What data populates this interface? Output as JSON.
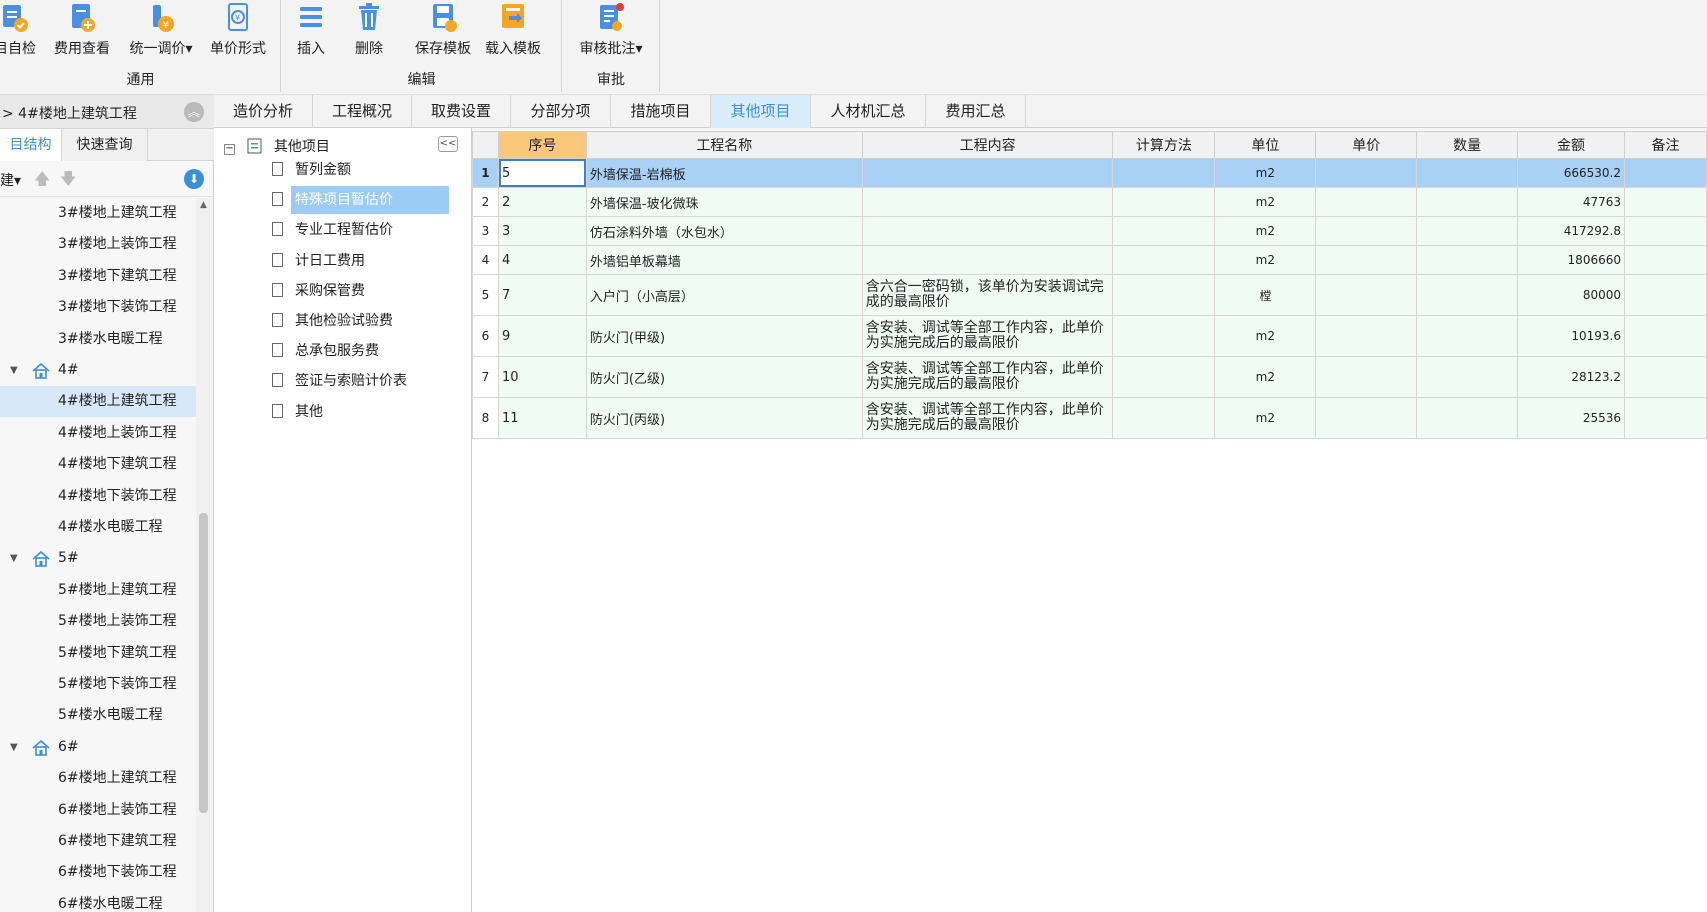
{
  "ribbon": {
    "groups": [
      {
        "name": "通用",
        "buttons": [
          "目自检",
          "费用查看",
          "统一调价▾",
          "单价形式"
        ]
      },
      {
        "name": "编辑",
        "buttons": [
          "插入",
          "删除",
          "保存模板",
          "载入模板"
        ]
      },
      {
        "name": "审批",
        "buttons": [
          "审核批注▾"
        ]
      }
    ]
  },
  "project": {
    "breadcrumb": "> 4#楼地上建筑工程",
    "tabs": [
      "目结构",
      "快速查询"
    ],
    "new_label": "建▾"
  },
  "tree": [
    {
      "label": "3#楼地上建筑工程",
      "type": "leaf"
    },
    {
      "label": "3#楼地上装饰工程",
      "type": "leaf"
    },
    {
      "label": "3#楼地下建筑工程",
      "type": "leaf"
    },
    {
      "label": "3#楼地下装饰工程",
      "type": "leaf"
    },
    {
      "label": "3#楼水电暖工程",
      "type": "leaf"
    },
    {
      "label": "4#",
      "type": "folder"
    },
    {
      "label": "4#楼地上建筑工程",
      "type": "leaf",
      "selected": true
    },
    {
      "label": "4#楼地上装饰工程",
      "type": "leaf"
    },
    {
      "label": "4#楼地下建筑工程",
      "type": "leaf"
    },
    {
      "label": "4#楼地下装饰工程",
      "type": "leaf"
    },
    {
      "label": "4#楼水电暖工程",
      "type": "leaf"
    },
    {
      "label": "5#",
      "type": "folder"
    },
    {
      "label": "5#楼地上建筑工程",
      "type": "leaf"
    },
    {
      "label": "5#楼地上装饰工程",
      "type": "leaf"
    },
    {
      "label": "5#楼地下建筑工程",
      "type": "leaf"
    },
    {
      "label": "5#楼地下装饰工程",
      "type": "leaf"
    },
    {
      "label": "5#楼水电暖工程",
      "type": "leaf"
    },
    {
      "label": "6#",
      "type": "folder"
    },
    {
      "label": "6#楼地上建筑工程",
      "type": "leaf"
    },
    {
      "label": "6#楼地上装饰工程",
      "type": "leaf"
    },
    {
      "label": "6#楼地下建筑工程",
      "type": "leaf"
    },
    {
      "label": "6#楼地下装饰工程",
      "type": "leaf"
    },
    {
      "label": "6#楼水电暖工程",
      "type": "leaf"
    }
  ],
  "main_tabs": {
    "items": [
      "造价分析",
      "工程概况",
      "取费设置",
      "分部分项",
      "措施项目",
      "其他项目",
      "人材机汇总",
      "费用汇总"
    ],
    "active": "其他项目"
  },
  "categories": {
    "root": "其他项目",
    "items": [
      "暂列金额",
      "特殊项目暂估价",
      "专业工程暂估价",
      "计日工费用",
      "采购保管费",
      "其他检验试验费",
      "总承包服务费",
      "签证与索赔计价表",
      "其他"
    ],
    "selected": "特殊项目暂估价"
  },
  "grid": {
    "columns": [
      "序号",
      "工程名称",
      "工程内容",
      "计算方法",
      "单位",
      "单价",
      "数量",
      "金额",
      "备注"
    ],
    "rows": [
      {
        "n": "1",
        "seq": "5",
        "name": "外墙保温-岩棉板",
        "content": "",
        "unit": "m2",
        "amount": "666530.2"
      },
      {
        "n": "2",
        "seq": "2",
        "name": "外墙保温-玻化微珠",
        "content": "",
        "unit": "m2",
        "amount": "47763"
      },
      {
        "n": "3",
        "seq": "3",
        "name": "仿石涂料外墙（水包水）",
        "content": "",
        "unit": "m2",
        "amount": "417292.8"
      },
      {
        "n": "4",
        "seq": "4",
        "name": "外墙铝单板幕墙",
        "content": "",
        "unit": "m2",
        "amount": "1806660"
      },
      {
        "n": "5",
        "seq": "7",
        "name": "入户门（小高层）",
        "content": "含六合一密码锁，该单价为安装调试完成的最高限价",
        "unit": "樘",
        "amount": "80000"
      },
      {
        "n": "6",
        "seq": "9",
        "name": "防火门(甲级)",
        "content": "含安装、调试等全部工作内容，此单价为实施完成后的最高限价",
        "unit": "m2",
        "amount": "10193.6"
      },
      {
        "n": "7",
        "seq": "10",
        "name": "防火门(乙级)",
        "content": "含安装、调试等全部工作内容，此单价为实施完成后的最高限价",
        "unit": "m2",
        "amount": "28123.2"
      },
      {
        "n": "8",
        "seq": "11",
        "name": "防火门(丙级)",
        "content": "含安装、调试等全部工作内容，此单价为实施完成后的最高限价",
        "unit": "m2",
        "amount": "25536"
      }
    ]
  }
}
